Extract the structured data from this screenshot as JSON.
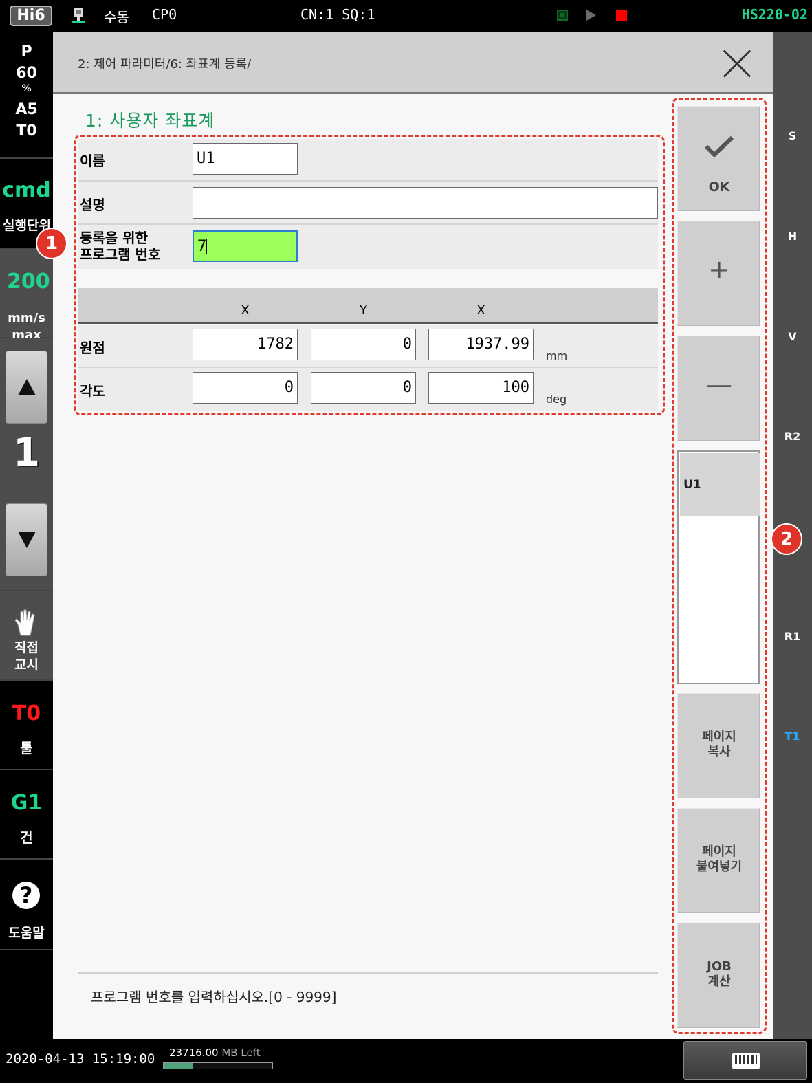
{
  "topbar": {
    "logo": "Hi6",
    "mode": "수동",
    "cp": "CP0",
    "cn_sq": "CN:1 SQ:1",
    "robot_model": "HS220-02"
  },
  "leftbar": {
    "speed_override": {
      "prefix": "P",
      "value": "60",
      "unit": "%",
      "a_value": "A5",
      "t_value": "T0"
    },
    "cmd": {
      "label": "cmd",
      "sub": "실행단위"
    },
    "manual_speed": {
      "value": "200",
      "unit_line1": "mm/s",
      "unit_line2": "max"
    },
    "speed_step": "1",
    "direct_teach": {
      "line1": "직접",
      "line2": "교시"
    },
    "tool": {
      "value": "T0",
      "label": "툴"
    },
    "gun": {
      "value": "G1",
      "label": "건"
    },
    "help": {
      "glyph": "?",
      "label": "도움말"
    }
  },
  "axes": [
    "S",
    "H",
    "V",
    "R2",
    "R1",
    "T1"
  ],
  "axes_active": "T1",
  "header": {
    "breadcrumb": "2: 제어 파라미터/6: 좌표계 등록/"
  },
  "form": {
    "section_title": "1: 사용자 좌표계",
    "name_label": "이름",
    "name_value": "U1",
    "description_label": "설명",
    "description_value": "",
    "program_label_line1": "등록을 위한",
    "program_label_line2": "프로그램 번호",
    "program_value": "7",
    "columns": [
      "X",
      "Y",
      "X"
    ],
    "origin_label": "원점",
    "origin_values": [
      "1782",
      "0",
      "1937.99"
    ],
    "origin_unit": "mm",
    "angle_label": "각도",
    "angle_values": [
      "0",
      "0",
      "100"
    ],
    "angle_unit": "deg"
  },
  "prompt": "프로그램 번호를 입력하십시오.[0 - 9999]",
  "softkeys": {
    "ok_label": "OK",
    "add_glyph": "+",
    "remove_glyph": "—",
    "list_items": [
      "U1"
    ],
    "copy_page_line1": "페이지",
    "copy_page_line2": "복사",
    "paste_page_line1": "페이지",
    "paste_page_line2": "붙여넣기",
    "job_calc_line1": "JOB",
    "job_calc_line2": "계산"
  },
  "callouts": {
    "first": "1",
    "second": "2"
  },
  "bottombar": {
    "datetime": "2020-04-13 15:19:00",
    "memory_value": "23716.00",
    "memory_unit": "MB Left",
    "memory_used_fraction": 0.27
  },
  "colors": {
    "accent_green": "#1fd58e",
    "title_green": "#1a9a5c",
    "alert_red": "#ff1a1a",
    "callout_red": "#e0332a",
    "active_axis_blue": "#2aaaf0",
    "input_focus_green": "#9cff5c"
  },
  "icons": {
    "teach_pendant": "teach-pendant-icon",
    "motor_status": "motor-off-indicator",
    "play": "play-icon",
    "stop": "stop-icon",
    "close": "close-icon",
    "ok": "check-icon",
    "hand": "hand-icon",
    "help": "question-icon",
    "keyboard": "keyboard-icon"
  }
}
